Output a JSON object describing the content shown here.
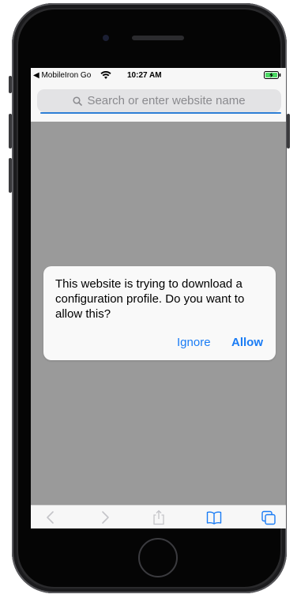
{
  "statusbar": {
    "carrier": "◀ MobileIron Go",
    "time": "10:27 AM"
  },
  "search": {
    "placeholder": "Search or enter website name"
  },
  "dialog": {
    "message": "This website is trying to download a configuration profile. Do you want to allow this?",
    "ignore_label": "Ignore",
    "allow_label": "Allow"
  },
  "toolbar": {
    "icons": [
      "back-icon",
      "forward-icon",
      "share-icon",
      "bookmarks-icon",
      "tabs-icon"
    ]
  },
  "colors": {
    "accent": "#1a7cf5",
    "screen_dim": "#9a9a9a",
    "battery": "#4cd964"
  }
}
